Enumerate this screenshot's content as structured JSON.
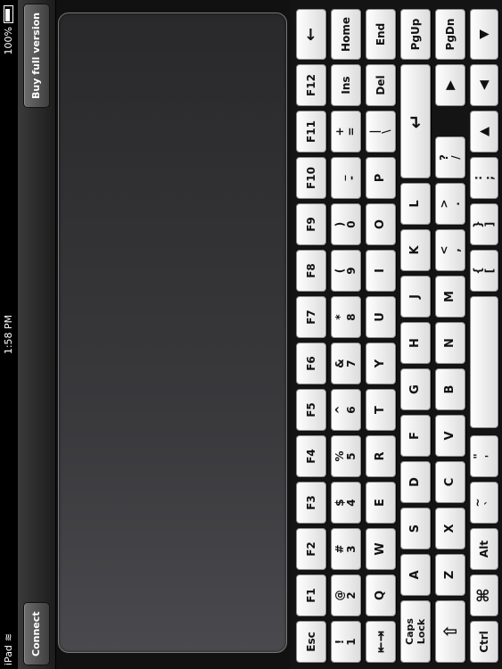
{
  "status": {
    "device": "iPad",
    "time": "1:58 PM",
    "battery": "100%"
  },
  "toolbar": {
    "connect": "Connect",
    "buy": "Buy full version"
  },
  "keys": {
    "esc": "Esc",
    "f1": "F1",
    "f2": "F2",
    "f3": "F3",
    "f4": "F4",
    "f5": "F5",
    "f6": "F6",
    "f7": "F7",
    "f8": "F8",
    "f9": "F9",
    "f10": "F10",
    "f11": "F11",
    "f12": "F12",
    "backspace": "←",
    "n1_top": "!",
    "n1_bot": "1",
    "n2_top": "@",
    "n2_bot": "2",
    "n3_top": "#",
    "n3_bot": "3",
    "n4_top": "$",
    "n4_bot": "4",
    "n5_top": "%",
    "n5_bot": "5",
    "n6_top": "^",
    "n6_bot": "6",
    "n7_top": "&",
    "n7_bot": "7",
    "n8_top": "*",
    "n8_bot": "8",
    "n9_top": "(",
    "n9_bot": "9",
    "n0_top": ")",
    "n0_bot": "0",
    "minus_top": "_",
    "minus_bot": "-",
    "equals_top": "+",
    "equals_bot": "=",
    "ins": "Ins",
    "home": "Home",
    "tab": "⇤⇥",
    "q": "Q",
    "w": "W",
    "e": "E",
    "r": "R",
    "t": "T",
    "y": "Y",
    "u": "U",
    "i": "I",
    "o": "O",
    "p": "P",
    "bslash_top": "|",
    "bslash_bot": "\\",
    "del": "Del",
    "end": "End",
    "caps_top": "Caps",
    "caps_bot": "Lock",
    "a": "A",
    "s": "S",
    "d": "D",
    "f": "F",
    "g": "G",
    "h": "H",
    "j": "J",
    "k": "K",
    "l": "L",
    "enter": "↵",
    "pgup": "PgUp",
    "shift": "⇧",
    "z": "Z",
    "x": "X",
    "c": "C",
    "v": "V",
    "b": "B",
    "n": "N",
    "m": "M",
    "comma_top": "<",
    "comma_bot": ",",
    "period_top": ">",
    "period_bot": ".",
    "slash_top": "?",
    "slash_bot": "/",
    "right": "▶",
    "pgdn": "PgDn",
    "ctrl": "Ctrl",
    "cmd": "⌘",
    "alt": "Alt",
    "tilde_top": "~",
    "tilde_bot": "`",
    "quote_top": "\"",
    "quote_bot": "'",
    "space": "",
    "lbrace_top": "{",
    "lbrace_bot": "[",
    "rbrace_top": "}",
    "rbrace_bot": "]",
    "semi_top": ":",
    "semi_bot": ";",
    "up": "▲",
    "left": "◀",
    "down": "▼"
  }
}
